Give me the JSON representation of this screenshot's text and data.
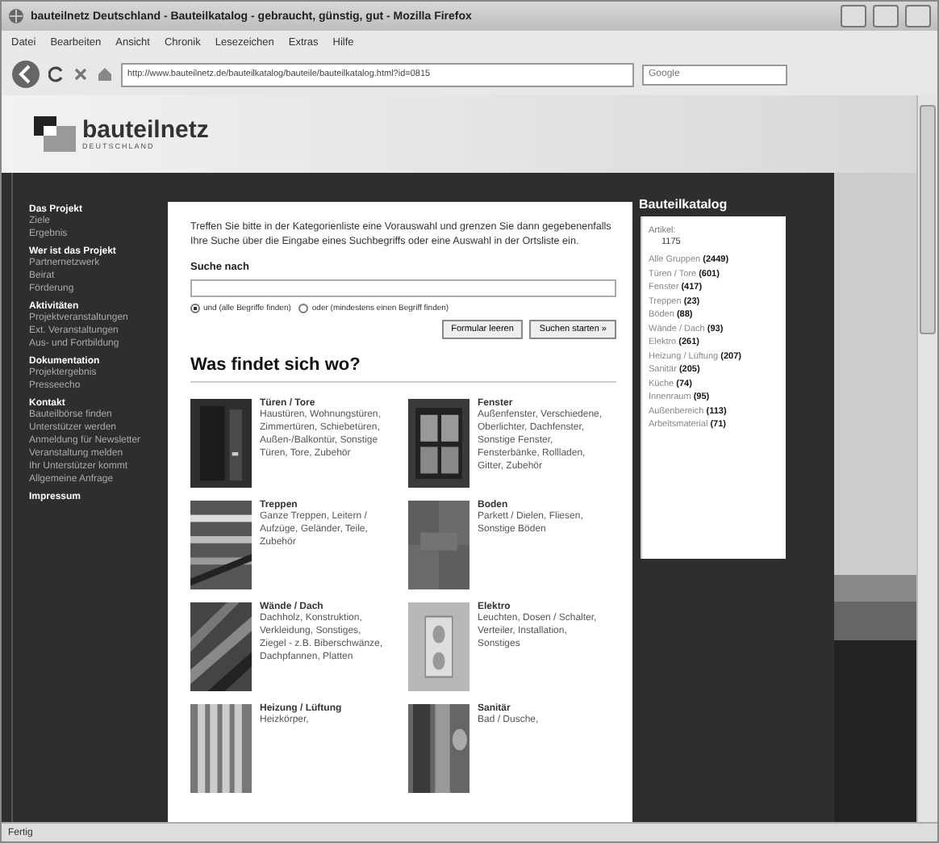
{
  "window": {
    "title": "bauteilnetz Deutschland - Bauteilkatalog - gebraucht, günstig, gut - Mozilla Firefox"
  },
  "menu": [
    "Datei",
    "Bearbeiten",
    "Ansicht",
    "Chronik",
    "Lesezeichen",
    "Extras",
    "Hilfe"
  ],
  "address_bar": {
    "url": "http://www.bauteilnetz.de/bauteilkatalog/bauteile/bauteilkatalog.html?id=0815"
  },
  "search": {
    "placeholder": "Google"
  },
  "logo": {
    "name": "bauteilnetz",
    "tagline": "DEUTSCHLAND"
  },
  "sidebar": {
    "sections": [
      {
        "title": "Das Projekt",
        "items": [
          "Ziele",
          "Ergebnis"
        ]
      },
      {
        "title": "Wer ist das Projekt",
        "items": [
          "Partnernetzwerk",
          "Beirat",
          "Förderung"
        ]
      },
      {
        "title": "Aktivitäten",
        "items": [
          "Projektveranstaltungen",
          "Ext. Veranstaltungen",
          "Aus- und Fortbildung"
        ]
      },
      {
        "title": "Dokumentation",
        "items": [
          "Projektergebnis",
          "Presseecho"
        ]
      },
      {
        "title": "Kontakt",
        "items": [
          "Bauteilbörse finden",
          "Unterstützer werden",
          "Anmeldung für Newsletter",
          "Veranstaltung melden",
          "Ihr Unterstützer kommt",
          "Allgemeine Anfrage"
        ]
      },
      {
        "title": "Impressum"
      }
    ]
  },
  "intro": "Treffen Sie bitte in der Kategorienliste eine Vorauswahl und grenzen Sie dann gegebenenfalls Ihre Suche über die Eingabe eines Suchbegriffs oder eine Auswahl in der Ortsliste ein.",
  "search_form": {
    "label": "Suche nach",
    "options": [
      {
        "label": "und (alle Begriffe finden)",
        "selected": true
      },
      {
        "label": "oder (mindestens einen Begriff finden)",
        "selected": false
      }
    ],
    "buttons": [
      "Formular leeren",
      "Suchen starten »"
    ]
  },
  "heading": "Was findet sich wo?",
  "categories": [
    {
      "title": "Türen / Tore",
      "text": "Haustüren, Wohnungstüren, Zimmertüren, Schiebetüren, Außen-/Balkontür, Sonstige Türen, Tore, Zubehör"
    },
    {
      "title": "Fenster",
      "text": "Außenfenster, Verschiedene, Oberlichter, Dachfenster, Sonstige Fenster, Fensterbänke, Rollladen, Gitter, Zubehör"
    },
    {
      "title": "Treppen",
      "text": "Ganze Treppen, Leitern / Aufzüge, Geländer, Teile, Zubehör"
    },
    {
      "title": "Boden",
      "text": "Parkett / Dielen, Fliesen, Sonstige Böden"
    },
    {
      "title": "Wände / Dach",
      "text": "Dachholz, Konstruktion, Verkleidung, Sonstiges, Ziegel - z.B. Biberschwänze, Dachpfannen, Platten"
    },
    {
      "title": "Elektro",
      "text": "Leuchten, Dosen / Schalter, Verteiler, Installation, Sonstiges"
    },
    {
      "title": "Heizung / Lüftung",
      "text": "Heizkörper,"
    },
    {
      "title": "Sanitär",
      "text": "Bad / Dusche,"
    }
  ],
  "catalog": {
    "title": "Bauteilkatalog",
    "count_label": "Artikel:",
    "count": "1175",
    "groups": [
      {
        "name": "Alle Gruppen",
        "count": "(2449)"
      },
      {
        "name": "Türen / Tore",
        "count": "(601)"
      },
      {
        "name": "Fenster",
        "count": "(417)"
      },
      {
        "name": "Treppen",
        "count": "(23)"
      },
      {
        "name": "Böden",
        "count": "(88)"
      },
      {
        "name": "Wände / Dach",
        "count": "(93)"
      },
      {
        "name": "Elektro",
        "count": "(261)"
      },
      {
        "name": "Heizung / Lüftung",
        "count": "(207)"
      },
      {
        "name": "Sanitär",
        "count": "(205)"
      },
      {
        "name": "Küche",
        "count": "(74)"
      },
      {
        "name": "Innenraum",
        "count": "(95)"
      },
      {
        "name": "Außenbereich",
        "count": "(113)"
      },
      {
        "name": "Arbeitsmaterial",
        "count": "(71)"
      }
    ]
  },
  "status_bar": "Fertig"
}
